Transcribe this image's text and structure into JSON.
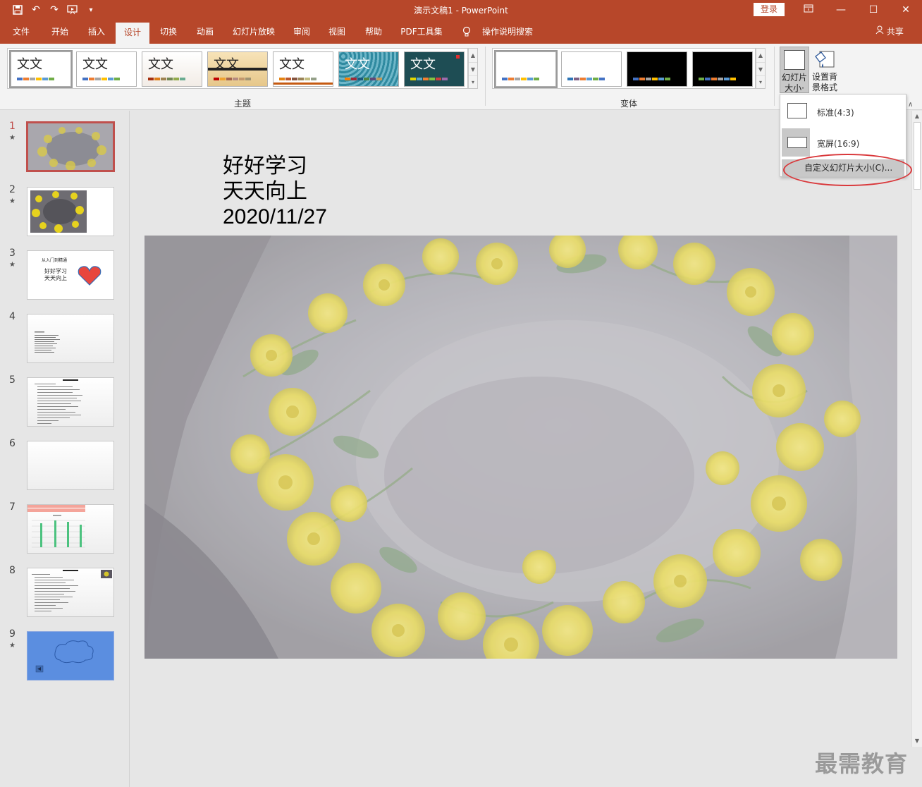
{
  "window": {
    "title": "演示文稿1 - PowerPoint",
    "login_label": "登录"
  },
  "menu": {
    "tabs": [
      "文件",
      "开始",
      "插入",
      "设计",
      "切换",
      "动画",
      "幻灯片放映",
      "审阅",
      "视图",
      "帮助",
      "PDF工具集"
    ],
    "active_tab": "设计",
    "search_label": "操作说明搜索",
    "share_label": "共享"
  },
  "ribbon": {
    "themes_label": "主题",
    "variants_label": "变体",
    "theme_text": "文文",
    "slide_size_label": "幻灯片大小",
    "slide_size_line1": "幻灯片",
    "slide_size_line2": "大小·",
    "bg_format_line1": "设置背",
    "bg_format_line2": "景格式"
  },
  "dropdown": {
    "standard": "标准(4:3)",
    "widescreen": "宽屏(16:9)",
    "custom": "自定义幻灯片大小(C)..."
  },
  "slides": [
    {
      "num": "1",
      "star": "★"
    },
    {
      "num": "2",
      "star": "★"
    },
    {
      "num": "3",
      "star": "★",
      "title": "从入门到精通",
      "body": "好好学习\n天天向上"
    },
    {
      "num": "4",
      "star": ""
    },
    {
      "num": "5",
      "star": ""
    },
    {
      "num": "6",
      "star": ""
    },
    {
      "num": "7",
      "star": ""
    },
    {
      "num": "8",
      "star": ""
    },
    {
      "num": "9",
      "star": "★"
    }
  ],
  "slide_content": {
    "line1": "好好学习",
    "line2": "天天向上",
    "line3": "2020/11/27"
  },
  "watermark": "最需教育",
  "colors": {
    "accent": "#b7472a",
    "highlight_oval": "#d9373a"
  }
}
